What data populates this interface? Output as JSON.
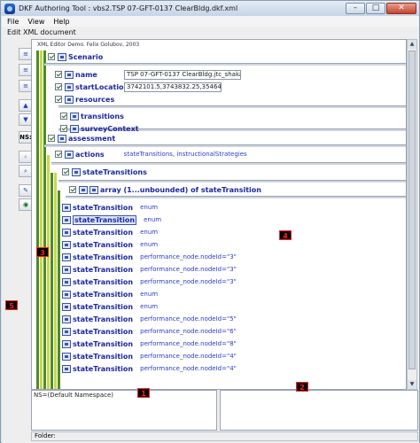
{
  "window": {
    "title": "DKF Authoring Tool : vbs2.TSP 07-GFT-0137 ClearBldg.dkf.xml"
  },
  "window_controls": [
    "–",
    "□",
    "✕"
  ],
  "menu": [
    "File",
    "View",
    "Help"
  ],
  "panel_title": "Edit XML document",
  "editor_header": "XML Editor Demo.  Felix Golubov, 2003",
  "toolbar_icons": [
    "align-left-icon",
    "align-center-icon",
    "align-right-icon",
    "arrow-up-icon",
    "arrow-down-icon",
    "ns-icon",
    "zoom-in-icon",
    "zoom-out-icon",
    "pen-icon",
    "eye-icon"
  ],
  "toolbar_ns_label": "NS:",
  "tree": {
    "scenario": "Scenario",
    "name_label": "name",
    "name_value": "TSP 07-GFT-0137 ClearBldg.jtc_shakarat",
    "start_label": "startLocation",
    "start_value": "3742101.5,3743832.25,3546412.5",
    "resources": "resources",
    "transitions": "transitions",
    "survey": "surveyContext",
    "assessment": "assessment",
    "actions": "actions",
    "actions_value": "stateTransitions, instructionalStrategies",
    "state_transitions": "stateTransitions",
    "array_label": "array (1...unbounded) of stateTransition",
    "items": [
      {
        "label": "stateTransition",
        "value": "enum"
      },
      {
        "label": "stateTransition",
        "value": "enum"
      },
      {
        "label": "stateTransition",
        "value": "enum"
      },
      {
        "label": "stateTransition",
        "value": "enum"
      },
      {
        "label": "stateTransition",
        "value": "performance_node.nodeId=\"3\""
      },
      {
        "label": "stateTransition",
        "value": "performance_node.nodeId=\"3\""
      },
      {
        "label": "stateTransition",
        "value": "performance_node.nodeId=\"3\""
      },
      {
        "label": "stateTransition",
        "value": "enum"
      },
      {
        "label": "stateTransition",
        "value": "enum"
      },
      {
        "label": "stateTransition",
        "value": "performance_node.nodeId=\"5\""
      },
      {
        "label": "stateTransition",
        "value": "performance_node.nodeId=\"6\""
      },
      {
        "label": "stateTransition",
        "value": "performance_node.nodeId=\"8\""
      },
      {
        "label": "stateTransition",
        "value": "performance_node.nodeId=\"4\""
      },
      {
        "label": "stateTransition",
        "value": "performance_node.nodeId=\"4\""
      }
    ]
  },
  "namespace_text": "NS=(Default Namespace)",
  "folder_label": "Folder:",
  "markers": [
    "1",
    "2",
    "3",
    "4",
    "5"
  ],
  "colors": {
    "bar_green": "#4e8a2a",
    "bar_lime": "#c7d84a",
    "label_blue": "#1b27a0",
    "value_blue": "#2b3bc8",
    "marker_red": "#ff2020"
  }
}
